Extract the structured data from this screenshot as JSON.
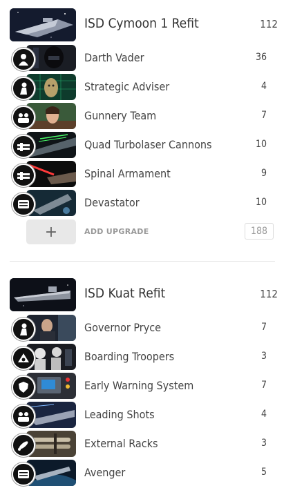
{
  "fleets": [
    {
      "ship": {
        "name": "ISD Cymoon 1 Refit",
        "cost": "112",
        "image": "star-destroyer-cymoon"
      },
      "upgrades": [
        {
          "name": "Darth Vader",
          "cost": "36",
          "slot_icon": "commander-icon",
          "image": "darth-vader"
        },
        {
          "name": "Strategic Adviser",
          "cost": "4",
          "slot_icon": "officer-icon",
          "image": "strategic-adviser"
        },
        {
          "name": "Gunnery Team",
          "cost": "7",
          "slot_icon": "weapons-team-icon",
          "image": "gunnery-team"
        },
        {
          "name": "Quad Turbolaser Cannons",
          "cost": "10",
          "slot_icon": "turbolaser-icon",
          "image": "quad-turbolasers"
        },
        {
          "name": "Spinal Armament",
          "cost": "9",
          "slot_icon": "turbolaser-icon",
          "image": "spinal-armament"
        },
        {
          "name": "Devastator",
          "cost": "10",
          "slot_icon": "title-icon",
          "image": "devastator"
        }
      ],
      "add_upgrade": {
        "plus": "+",
        "label": "ADD UPGRADE",
        "total": "188"
      }
    },
    {
      "ship": {
        "name": "ISD Kuat Refit",
        "cost": "112",
        "image": "star-destroyer-kuat"
      },
      "upgrades": [
        {
          "name": "Governor Pryce",
          "cost": "7",
          "slot_icon": "officer-icon",
          "image": "governor-pryce"
        },
        {
          "name": "Boarding Troopers",
          "cost": "3",
          "slot_icon": "offensive-retrofit-icon",
          "image": "boarding-troopers"
        },
        {
          "name": "Early Warning System",
          "cost": "7",
          "slot_icon": "defensive-retrofit-icon",
          "image": "early-warning-system"
        },
        {
          "name": "Leading Shots",
          "cost": "4",
          "slot_icon": "weapons-team-icon",
          "image": "leading-shots"
        },
        {
          "name": "External Racks",
          "cost": "3",
          "slot_icon": "ordnance-icon",
          "image": "external-racks"
        },
        {
          "name": "Avenger",
          "cost": "5",
          "slot_icon": "title-icon",
          "image": "avenger"
        }
      ]
    }
  ],
  "colors": {
    "text": "#333333",
    "muted": "#999999",
    "divider": "#e4e4e4",
    "button_bg": "#e8e8e8"
  }
}
